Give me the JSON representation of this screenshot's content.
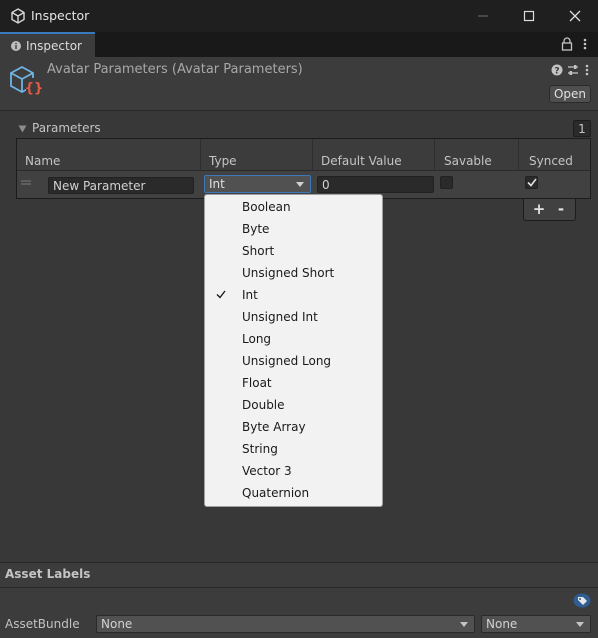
{
  "window": {
    "title": "Inspector"
  },
  "tabs": [
    {
      "label": "Inspector"
    }
  ],
  "header": {
    "asset_title": "Avatar Parameters (Avatar Parameters)",
    "open_label": "Open"
  },
  "parameters": {
    "label": "Parameters",
    "count": "1",
    "columns": {
      "name": "Name",
      "type": "Type",
      "default_value": "Default Value",
      "savable": "Savable",
      "synced": "Synced"
    },
    "rows": [
      {
        "name": "New Parameter",
        "type": "Int",
        "default_value": "0",
        "savable": false,
        "synced": true
      }
    ],
    "add_label": "+",
    "remove_label": "-"
  },
  "type_dropdown": {
    "selected": "Int",
    "options": [
      "Boolean",
      "Byte",
      "Short",
      "Unsigned Short",
      "Int",
      "Unsigned Int",
      "Long",
      "Unsigned Long",
      "Float",
      "Double",
      "Byte Array",
      "String",
      "Vector 3",
      "Quaternion"
    ]
  },
  "asset_labels": {
    "title": "Asset Labels",
    "asset_bundle_label": "AssetBundle",
    "bundle_value": "None",
    "variant_value": "None"
  },
  "colors": {
    "accent": "#3a79bb",
    "background": "#383838",
    "popup_bg": "#f2f2f2"
  }
}
